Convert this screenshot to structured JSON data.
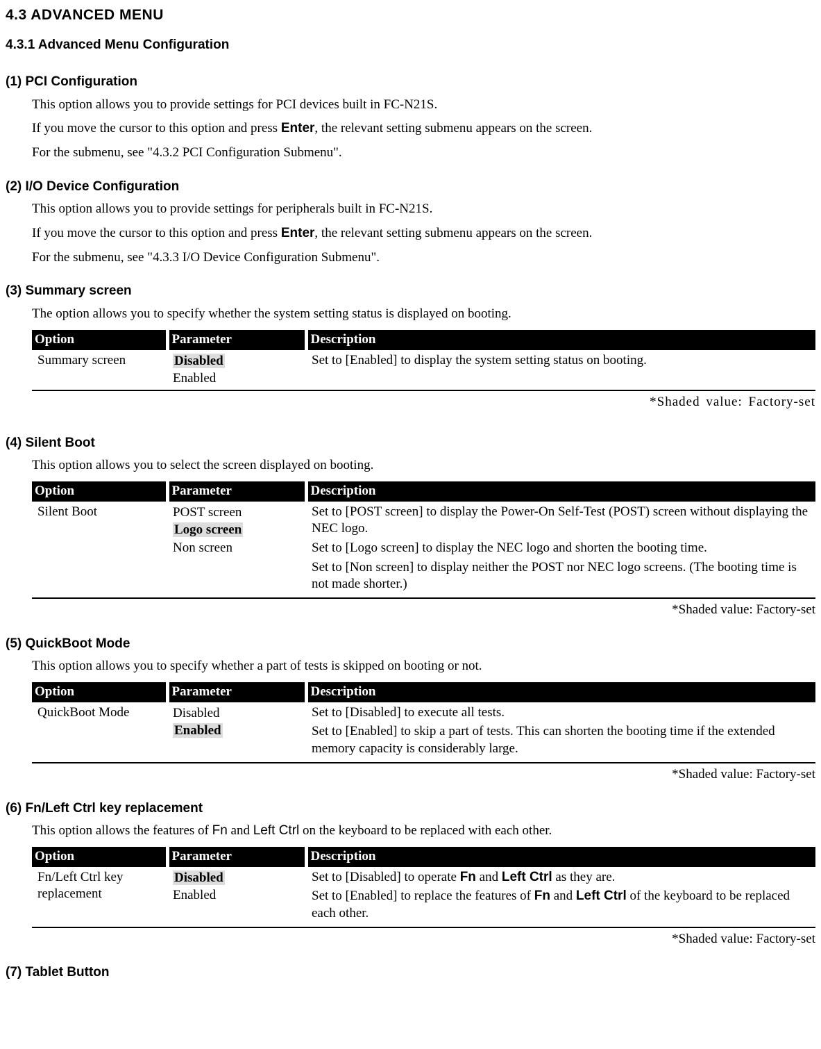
{
  "section_num_title": "4.3    ADVANCED MENU",
  "subsection_title": "4.3.1  Advanced Menu Configuration",
  "item1": {
    "heading": "(1) PCI Configuration",
    "p1": "This option allows you to provide settings for PCI devices built in FC-N21S.",
    "p2a": "If you move the cursor to this option and press ",
    "p2b": "Enter",
    "p2c": ", the relevant setting submenu appears on the screen.",
    "p3": "For the submenu, see \"4.3.2 PCI Configuration Submenu\"."
  },
  "item2": {
    "heading": "(2) I/O Device Configuration",
    "p1": "This option allows you to provide settings for peripherals built in FC-N21S.",
    "p2a": "If you move the cursor to this option and press ",
    "p2b": "Enter",
    "p2c": ", the relevant setting submenu appears on the screen.",
    "p3": "For the submenu, see \"4.3.3 I/O Device Configuration Submenu\"."
  },
  "headers": {
    "option": "Option",
    "parameter": "Parameter",
    "description": "Description"
  },
  "item3": {
    "heading": "(3) Summary screen",
    "p1": "The option allows you to specify whether the system setting status is displayed on booting.",
    "option": "Summary screen",
    "param1": "Disabled",
    "param2": "Enabled",
    "desc": "Set to [Enabled] to display the system setting status on booting.",
    "note": "*Shaded  value:  Factory-set"
  },
  "item4": {
    "heading": "(4) Silent Boot",
    "p1": "This option allows you to select the screen displayed on booting.",
    "option": "Silent Boot",
    "param1": "POST screen",
    "param2": "Logo screen",
    "param3": "Non screen",
    "desc1": "Set to [POST screen] to display the Power-On Self-Test (POST) screen without displaying the NEC logo.",
    "desc2": "Set to [Logo screen] to display the NEC logo and shorten the booting time.",
    "desc3": "Set to [Non screen] to display neither the POST nor NEC logo screens. (The booting time is not made shorter.)",
    "note": "*Shaded value: Factory-set"
  },
  "item5": {
    "heading": "(5) QuickBoot Mode",
    "p1": "This option allows you to specify whether a part of tests is skipped on booting or not.",
    "option": "QuickBoot Mode",
    "param1": "Disabled",
    "param2": "Enabled",
    "desc1": "Set to [Disabled] to execute all tests.",
    "desc2": "Set to [Enabled] to skip a part of tests. This can shorten the booting time if the extended memory capacity is considerably large.",
    "note": "*Shaded value: Factory-set"
  },
  "item6": {
    "heading": "(6) Fn/Left Ctrl key replacement",
    "p1a": "This option allows the features of ",
    "p1b": "Fn",
    "p1c": " and ",
    "p1d": "Left Ctrl",
    "p1e": " on the keyboard to be replaced with each other.",
    "option": "Fn/Left Ctrl key replacement",
    "param1": "Disabled",
    "param2": "Enabled",
    "desc1a": "Set to [Disabled] to operate ",
    "desc1b": "Fn",
    "desc1c": " and ",
    "desc1d": "Left Ctrl",
    "desc1e": " as they are.",
    "desc2a": "Set to [Enabled] to replace the features of ",
    "desc2b": "Fn",
    "desc2c": " and ",
    "desc2d": "Left Ctrl",
    "desc2e": " of the keyboard to be replaced each other.",
    "note": "*Shaded value: Factory-set"
  },
  "item7_heading": "(7) Tablet Button",
  "chart_data": {
    "type": "table",
    "tables": [
      {
        "title": "(3) Summary screen",
        "columns": [
          "Option",
          "Parameter",
          "Description"
        ],
        "rows": [
          {
            "Option": "Summary screen",
            "Parameter": [
              "Disabled",
              "Enabled"
            ],
            "FactoryDefault": "Disabled",
            "Description": "Set to [Enabled] to display the system setting status on booting."
          }
        ]
      },
      {
        "title": "(4) Silent Boot",
        "columns": [
          "Option",
          "Parameter",
          "Description"
        ],
        "rows": [
          {
            "Option": "Silent Boot",
            "Parameter": [
              "POST screen",
              "Logo screen",
              "Non screen"
            ],
            "FactoryDefault": "Logo screen",
            "Description": [
              "Set to [POST screen] to display the Power-On Self-Test (POST) screen without displaying the NEC logo.",
              "Set to [Logo screen] to display the NEC logo and shorten the booting time.",
              "Set to [Non screen] to display neither the POST nor NEC logo screens. (The booting time is not made shorter.)"
            ]
          }
        ]
      },
      {
        "title": "(5) QuickBoot Mode",
        "columns": [
          "Option",
          "Parameter",
          "Description"
        ],
        "rows": [
          {
            "Option": "QuickBoot Mode",
            "Parameter": [
              "Disabled",
              "Enabled"
            ],
            "FactoryDefault": "Enabled",
            "Description": [
              "Set to [Disabled] to execute all tests.",
              "Set to [Enabled] to skip a part of tests. This can shorten the booting time if the extended memory capacity is considerably large."
            ]
          }
        ]
      },
      {
        "title": "(6) Fn/Left Ctrl key replacement",
        "columns": [
          "Option",
          "Parameter",
          "Description"
        ],
        "rows": [
          {
            "Option": "Fn/Left Ctrl key replacement",
            "Parameter": [
              "Disabled",
              "Enabled"
            ],
            "FactoryDefault": "Disabled",
            "Description": [
              "Set to [Disabled] to operate Fn and Left Ctrl as they are.",
              "Set to [Enabled] to replace the features of Fn and Left Ctrl of the keyboard to be replaced each other."
            ]
          }
        ]
      }
    ]
  }
}
